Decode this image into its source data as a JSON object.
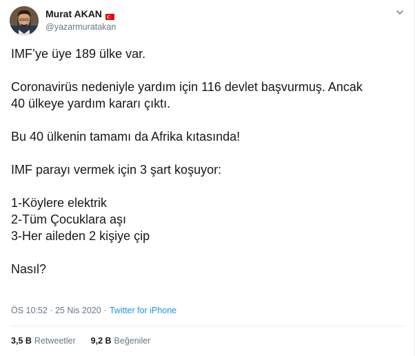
{
  "user": {
    "display_name": "Murat AKAN",
    "handle": "@yazarmuratakan",
    "flag_icon": "turkey-flag-icon",
    "colors": {
      "flag_red": "#e30a17"
    }
  },
  "tweet": {
    "paragraphs": [
      [
        "IMF’ye üye 189 ülke var."
      ],
      [
        "Coronavirüs nedeniyle yardım için 116 devlet başvurmuş. Ancak",
        "40 ülkeye yardım kararı çıktı."
      ],
      [
        "Bu 40 ülkenin tamamı da Afrika kıtasında!"
      ],
      [
        "IMF parayı vermek için 3 şart koşuyor:"
      ],
      [
        "1-Köylere elektrik",
        "2-Tüm Çocuklara aşı",
        "3-Her aileden 2 kişiye çip"
      ],
      [
        "Nasıl?"
      ]
    ]
  },
  "meta": {
    "time": "ÖS 10:52",
    "date": "25 Nis 2020",
    "separator": "·",
    "source": "Twitter for iPhone",
    "source_color": "#1b95e0"
  },
  "stats": {
    "retweets_count": "3,5 B",
    "retweets_label": "Retweetler",
    "likes_count": "9,2 B",
    "likes_label": "Beğeniler"
  }
}
